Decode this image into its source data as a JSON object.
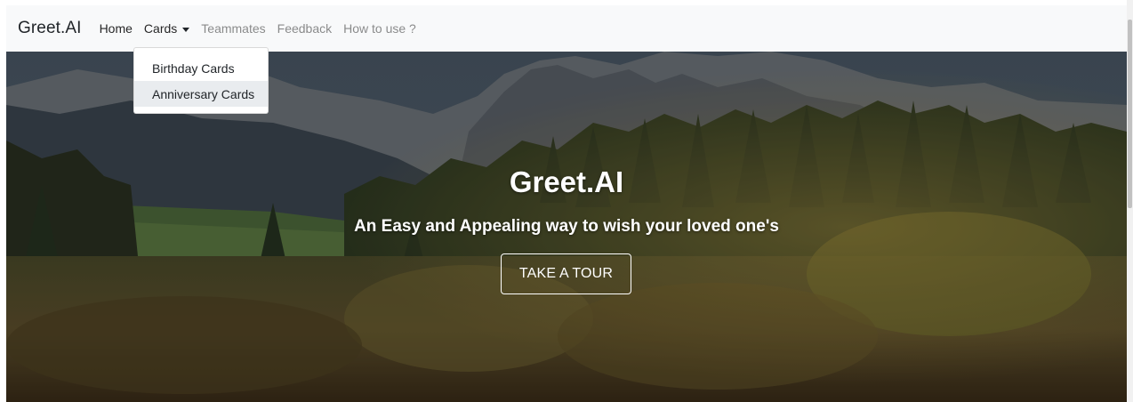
{
  "navbar": {
    "brand": "Greet.AI",
    "items": [
      {
        "label": "Home"
      },
      {
        "label": "Cards"
      },
      {
        "label": "Teammates"
      },
      {
        "label": "Feedback"
      },
      {
        "label": "How to use ?"
      }
    ]
  },
  "dropdown": {
    "items": [
      {
        "label": "Birthday Cards"
      },
      {
        "label": "Anniversary Cards"
      }
    ]
  },
  "hero": {
    "title": "Greet.AI",
    "subtitle": "An Easy and Appealing way to wish your loved one's",
    "button_label": "TAKE A TOUR"
  },
  "colors": {
    "navbar_bg": "#f8f9fa",
    "text_dark": "#212529",
    "hero_text": "#ffffff"
  }
}
